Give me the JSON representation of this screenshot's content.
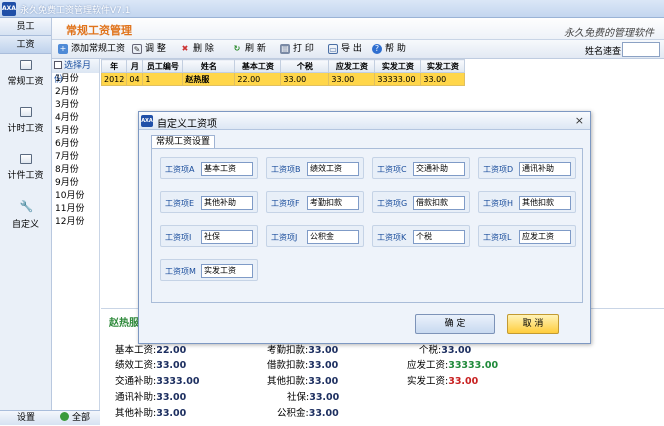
{
  "window": {
    "logo_text": "AXA",
    "title": "永久免费工资管理软件V7.1"
  },
  "nav": {
    "tabs": [
      {
        "label": "员工"
      },
      {
        "label": "工资"
      }
    ],
    "items": [
      {
        "label": "常规工资"
      },
      {
        "label": "计时工资"
      },
      {
        "label": "计件工资"
      },
      {
        "label": "自定义"
      }
    ],
    "bottom": "设置"
  },
  "header": {
    "title": "常规工资管理",
    "slogan": "永久免费的管理软件"
  },
  "toolbar": {
    "buttons": [
      {
        "label": "添加常规工资"
      },
      {
        "label": "调 整"
      },
      {
        "label": "删 除"
      },
      {
        "label": "刷 新"
      },
      {
        "label": "打 印"
      },
      {
        "label": "导 出"
      },
      {
        "label": "帮 助"
      }
    ],
    "search_label": "姓名速查:"
  },
  "months": {
    "select_label": "选择月份",
    "list": [
      "1月份",
      "2月份",
      "3月份",
      "4月份",
      "5月份",
      "6月份",
      "7月份",
      "8月份",
      "9月份",
      "10月份",
      "11月份",
      "12月份"
    ],
    "bottom": "全部"
  },
  "grid": {
    "headers": [
      "年",
      "月",
      "员工编号",
      "姓名",
      "基本工资",
      "个税",
      "应发工资",
      "实发工资",
      "实发工资"
    ],
    "row": [
      "2012",
      "04",
      "1",
      "赵热服",
      "22.00",
      "33.00",
      "33.00",
      "33333.00",
      "33.00"
    ]
  },
  "detail": {
    "name": "赵热服",
    "rows": [
      [
        {
          "k": "基本工资:",
          "v": "22.00"
        },
        {
          "k": "考勤扣款:",
          "v": "33.00"
        },
        {
          "k": "个税:",
          "v": "33.00"
        }
      ],
      [
        {
          "k": "绩效工资:",
          "v": "33.00"
        },
        {
          "k": "借款扣款:",
          "v": "33.00"
        },
        {
          "k": "应发工资:",
          "v": "33333.00"
        }
      ],
      [
        {
          "k": "交通补助:",
          "v": "3333.00"
        },
        {
          "k": "其他扣款:",
          "v": "33.00"
        },
        {
          "k": "实发工资:",
          "v": "33.00"
        }
      ],
      [
        {
          "k": "通讯补助:",
          "v": "33.00"
        },
        {
          "k": "社保:",
          "v": "33.00"
        }
      ],
      [
        {
          "k": "其他补助:",
          "v": "33.00"
        },
        {
          "k": "公积金:",
          "v": "33.00"
        }
      ]
    ]
  },
  "dialog": {
    "logo_text": "AXA",
    "title": "自定义工资项",
    "close": "×",
    "tab": "常规工资设置",
    "fields": [
      {
        "label": "工资项A",
        "value": "基本工资"
      },
      {
        "label": "工资项B",
        "value": "绩效工资"
      },
      {
        "label": "工资项C",
        "value": "交通补助"
      },
      {
        "label": "工资项D",
        "value": "通讯补助"
      },
      {
        "label": "工资项E",
        "value": "其他补助"
      },
      {
        "label": "工资项F",
        "value": "考勤扣款"
      },
      {
        "label": "工资项G",
        "value": "借款扣款"
      },
      {
        "label": "工资项H",
        "value": "其他扣款"
      },
      {
        "label": "工资项I",
        "value": "社保"
      },
      {
        "label": "工资项J",
        "value": "公积金"
      },
      {
        "label": "工资项K",
        "value": "个税"
      },
      {
        "label": "工资项L",
        "value": "应发工资"
      },
      {
        "label": "工资项M",
        "value": "实发工资"
      }
    ],
    "ok": "确 定",
    "cancel": "取 消"
  }
}
